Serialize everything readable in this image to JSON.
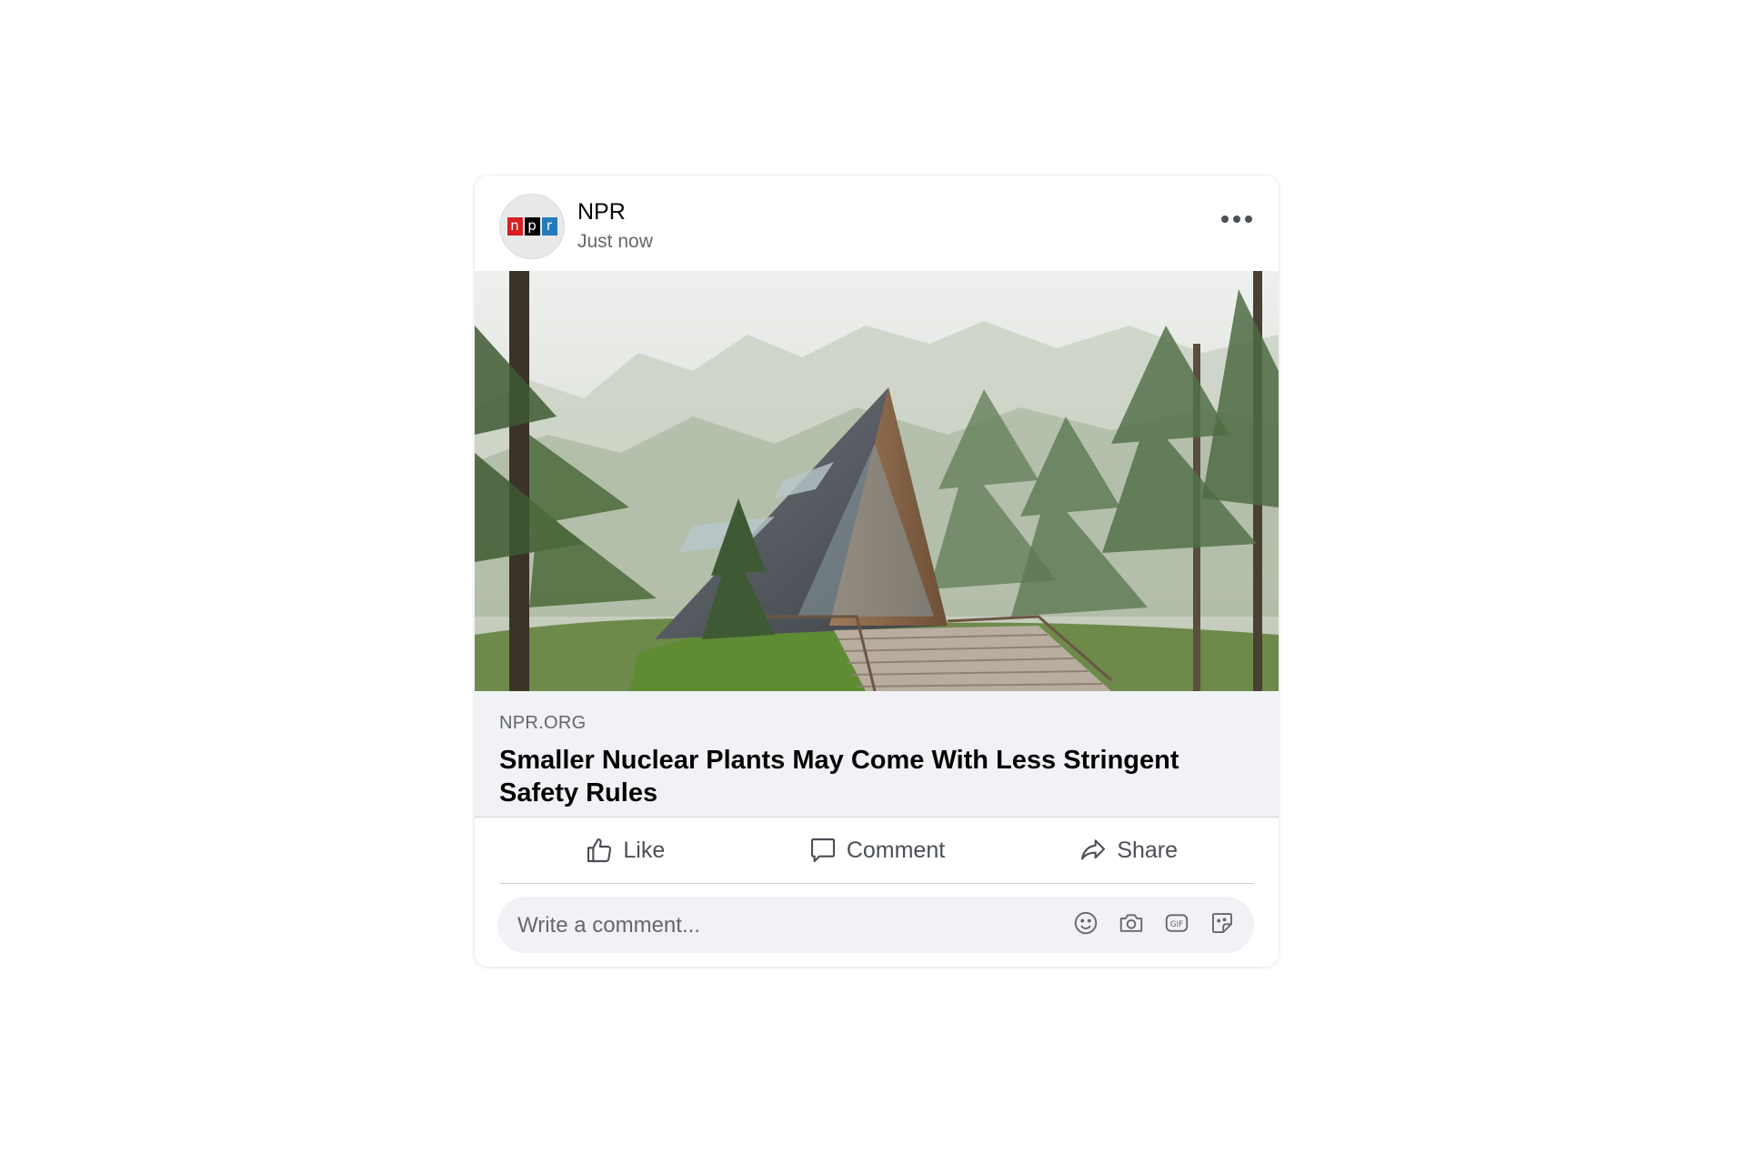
{
  "post": {
    "page_name": "NPR",
    "time": "Just now",
    "avatar_logo_letters": [
      "n",
      "p",
      "r"
    ],
    "image_description_icon": "article-thumbnail",
    "link": {
      "domain": "NPR.ORG",
      "title": "Smaller Nuclear Plants May Come With Less Stringent Safety Rules"
    },
    "actions": {
      "like_label": "Like",
      "comment_label": "Comment",
      "share_label": "Share"
    },
    "comment_box": {
      "placeholder": "Write a comment...",
      "icons": [
        "emoji-icon",
        "camera-icon",
        "gif-icon",
        "sticker-icon"
      ]
    }
  },
  "colors": {
    "npr_red": "#d62021",
    "npr_black": "#000000",
    "npr_blue": "#237bbd",
    "text_primary": "#050505",
    "text_secondary": "#65676b",
    "link_box_bg": "#f0f2f5"
  }
}
